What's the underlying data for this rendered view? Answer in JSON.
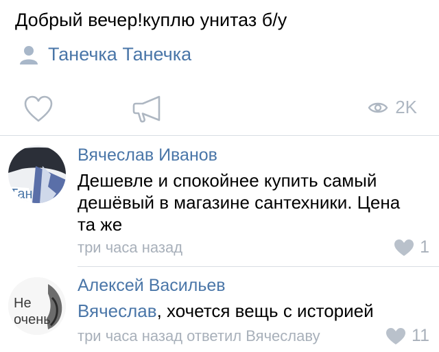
{
  "post": {
    "text": "Добрый вечер!куплю унитаз б/у",
    "author": "Танечка Танечка",
    "author_icon": "user-icon",
    "views": "2K"
  },
  "comments": [
    {
      "author": "Вячеслав Иванов",
      "text": "Дешевле и спокойнее купить самый дешёвый в магазине сантехники. Цена  та же",
      "time": "три часа назад",
      "likes": "1",
      "avatar_text": "Тан"
    },
    {
      "author": "Алексей Васильев",
      "mention": "Вячеслав",
      "text": ", хочется вещь с историей",
      "time": "три часа назад ответил Вячеславу",
      "likes": "11",
      "avatar_text": "Не очень"
    }
  ],
  "colors": {
    "link": "#4a76a8",
    "muted": "#a8b0ba",
    "divider": "#d8dde3"
  }
}
